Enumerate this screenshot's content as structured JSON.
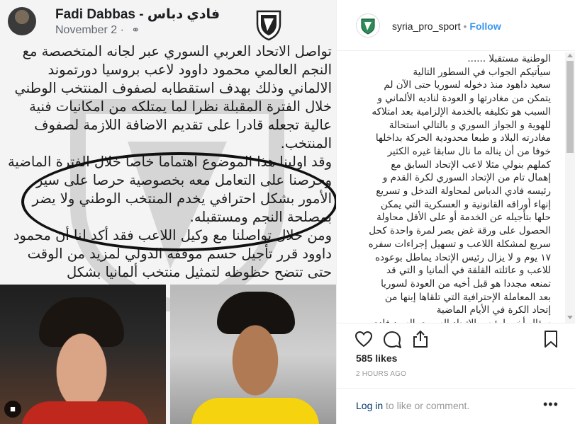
{
  "image": {
    "fb_name": "Fadi Dabbas - فادي دباس",
    "fb_date": "November 2",
    "fb_date_separator": "·",
    "fb_more": "···",
    "post_paragraphs": [
      "تواصل الاتحاد العربي السوري عبر لجانه المتخصصة مع النجم العالمي محمود داوود لاعب بروسيا دورتموند الالماني وذلك بهدف استقطابه لصفوف المنتخب الوطني خلال الفترة المقبلة نظرا لما يمتلكه من امكانيات فنية عالية تجعله قادرا على تقديم الاضافة اللازمة لصفوف المنتخب.",
      "وقد اولينا هذا الموضوع اهتماما خاصا خلال الفترة الماضية وحرصنا على التعامل معه بخصوصية حرصا على سير الأمور بشكل احترافي يخدم المنتخب الوطني ولا يضر بمصلحة النجم ومستقبله.",
      "ومن خلال تواصلنا مع وكيل اللاعب فقد أكد لنا أن محمود داوود قرر تأجيل حسم موقفه الدولي لمزيد من الوقت حتى تتضح حظوظه لتمثيل منتخب ألمانيا بشكل"
    ]
  },
  "sidebar": {
    "username": "syria_pro_sport",
    "separator": "•",
    "follow_label": "Follow",
    "caption_lines": [
      "الوطنية مستقبلا ......",
      "سيأتيكم الجواب في السطور التالية",
      "سعيد داهود منذ دخوله لسوريا حتى الآن لم",
      "يتمكن من مغادرتها و العودة لناديه الألماني و",
      "السبب هو تكليفه بالخدمة الإلزامية بعد امتلاكه",
      "للهوية و الجواز السوري و بالتالي استحالة",
      "مغادرته البلاد و طبعا محدودية الحركة بداخلها",
      "خوفا من أن يناله ما نال سابقا غيره الكثير",
      "كملهم بنولي مثلا لاعب الإتحاد السابق مع",
      "إهمال تام من الإتحاد السوري لكرة القدم و",
      "رئيسه فادي الدباس لمحاولة التدخل و تسريع",
      "إنهاء أوراقه القانونية و العسكرية التي يمكن",
      "حلها بتأجيله عن الخدمة أو على الأقل محاولة",
      "الحصول على ورقة غض بصر لمرة واحدة كحل",
      "سريع لمشكلة اللاعب و تسهيل إجراءات سفره",
      "١٧ يوم و لا يزال رئيس الإتحاد يماطل بوعوده",
      "للاعب و عائلته القلقة في ألمانيا و التي قد",
      "تمنعه مجددا هو قبل أخيه من العودة لسوريا",
      "بعد المعاملة الإحترافية التي تلقاها إبنها من",
      "إتحاد الكرة في الأيام الماضية",
      "سؤال أخير لرئيس الإتحاد السوري السيد فادي"
    ],
    "likes": "585 likes",
    "timestamp": "2 HOURS AGO",
    "login_link": "Log in",
    "login_rest": " to like or comment.",
    "more": "•••"
  }
}
